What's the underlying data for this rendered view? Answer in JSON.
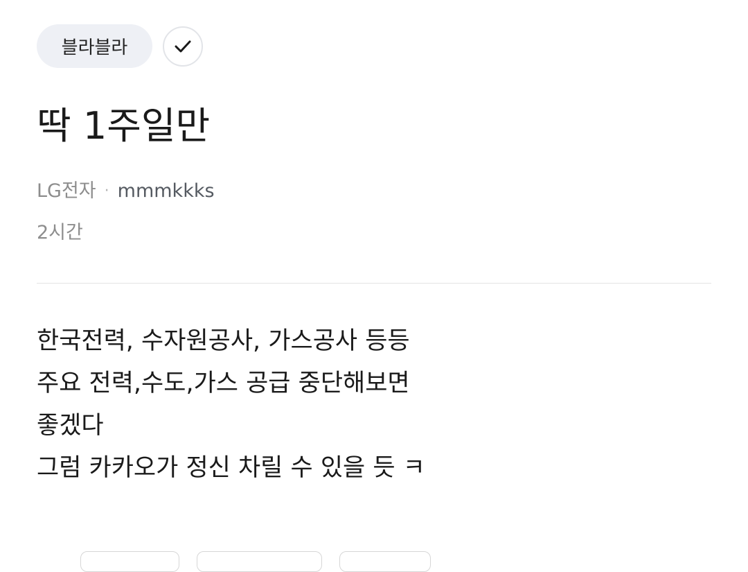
{
  "topic": {
    "label": "블라블라"
  },
  "icons": {
    "follow": "checkmark-icon"
  },
  "post": {
    "title": "딱 1주일만",
    "company": "LG전자",
    "separator": "·",
    "author": "mmmkkks",
    "time": "2시간",
    "body_lines": [
      "한국전력, 수자원공사, 가스공사 등등",
      "주요 전력,수도,가스 공급 중단해보면",
      "좋겠다",
      "그럼 카카오가 정신 차릴 수 있을 듯 ㅋ"
    ]
  }
}
